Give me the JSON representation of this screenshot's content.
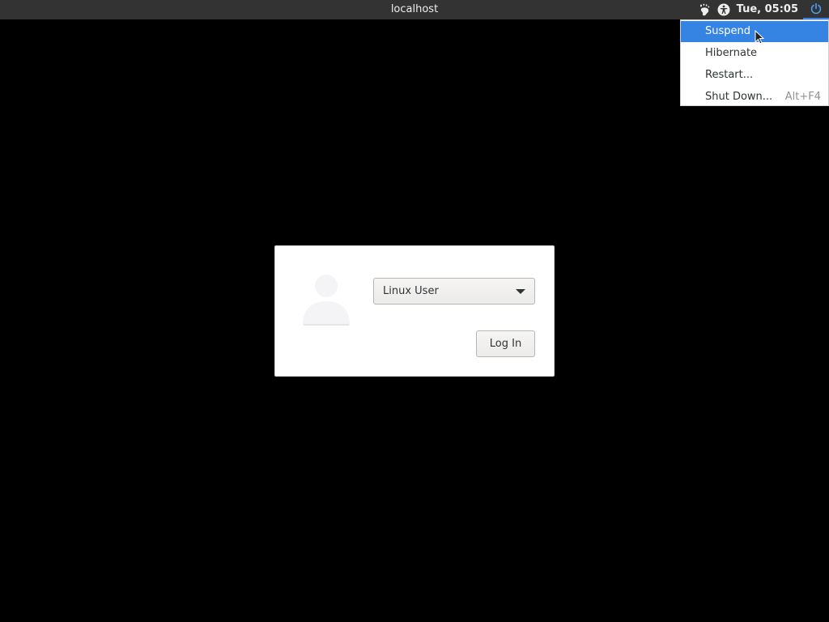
{
  "topbar": {
    "hostname": "localhost",
    "clock": "Tue, 05:05",
    "icons": [
      "gnome-foot-icon",
      "accessibility-icon",
      "power-icon"
    ]
  },
  "power_menu": {
    "items": [
      {
        "label": "Suspend",
        "accel": "",
        "active": true
      },
      {
        "label": "Hibernate",
        "accel": "",
        "active": false
      },
      {
        "label": "Restart...",
        "accel": "",
        "active": false
      },
      {
        "label": "Shut Down...",
        "accel": "Alt+F4",
        "active": false
      }
    ]
  },
  "login": {
    "selected_user": "Linux User",
    "login_label": "Log In"
  },
  "colors": {
    "topbar_bg": "#333333",
    "accent": "#3584e4",
    "background": "#000000",
    "menu_bg": "#ffffff"
  }
}
